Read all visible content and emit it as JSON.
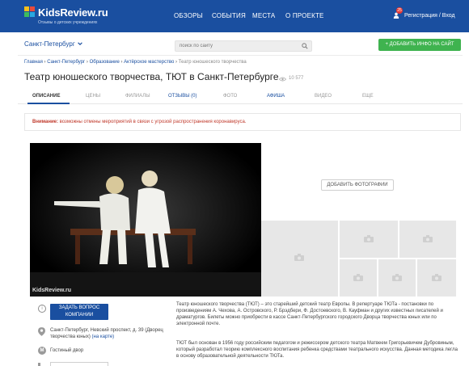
{
  "header": {
    "brand": "KidsReview.ru",
    "tagline": "Отзывы о детских учреждениях",
    "nav": [
      {
        "label": "ОБЗОРЫ"
      },
      {
        "label": "СОБЫТИЯ"
      },
      {
        "label": "МЕСТА"
      },
      {
        "label": "О ПРОЕКТЕ"
      }
    ],
    "notification_count": "25",
    "login_label": "Регистрация / Вход",
    "colors": {
      "bar": "#1a4fa0",
      "logo": [
        "#f7c01b",
        "#e94b3c",
        "#3dbb5e",
        "#29a7df"
      ]
    }
  },
  "subheader": {
    "city": "Санкт-Петербург",
    "search_placeholder": "поиск по сайту",
    "add_button": "+ ДОБАВИТЬ ИНФО НА САЙТ"
  },
  "breadcrumb": {
    "items": [
      "Главная",
      "Санкт-Петербург",
      "Образование",
      "Актёрское мастерство"
    ],
    "current": "Театр юношеского творчества"
  },
  "page": {
    "title": "Театр юношеского творчества, ТЮТ в Санкт-Петербурге",
    "views": "10 577"
  },
  "tabs": [
    {
      "label": "ОПИСАНИЕ",
      "state": "active"
    },
    {
      "label": "ЦЕНЫ",
      "state": "normal"
    },
    {
      "label": "ФИЛИАЛЫ",
      "state": "normal"
    },
    {
      "label": "ОТЗЫВЫ (0)",
      "state": "link"
    },
    {
      "label": "ФОТО",
      "state": "normal"
    },
    {
      "label": "АФИША",
      "state": "link"
    },
    {
      "label": "ВИДЕО",
      "state": "normal"
    },
    {
      "label": "ЕЩЕ",
      "state": "normal"
    }
  ],
  "notice": {
    "label": "Внимание:",
    "text": "возможны отмены мероприятий в связи с угрозой распространения коронавируса."
  },
  "gallery": {
    "watermark": "KidsReview.ru",
    "add_photo_label": "ДОБАВИТЬ ФОТОГРАФИИ",
    "icons": [
      "camera-icon"
    ]
  },
  "contact": {
    "ask_button": "ЗАДАТЬ ВОПРОС КОМПАНИИ",
    "address": "Санкт-Петербург, Невский проспект, д. 39 (Дворец творчества юных)",
    "map_link": "(на карте)",
    "metro": "Гостиный двор",
    "metro_letter": "М",
    "info_symbol": "i"
  },
  "description": {
    "p1": "Театр юношеского творчества (ТЮТ) – это старейший детский театр Европы. В репертуаре ТЮТа - постановки по произведениям А. Чехова, А. Островского, Р. Брэдбери, Ф. Достоевского, В. Кауфман и других известных писателей и драматургов. Билеты можно приобрести в кассе Санкт-Петербургского городского Дворца творчества юных или по электронной почте.",
    "p2": "ТЮТ был основан в 1956 году российским педагогом и режиссером детского театра Матвеем Григорьевичем Дубровиным, который разработал теорию комплексного воспитания ребенка средствами театрального искусства. Данная методика легла в основу образовательной деятельности ТЮТа."
  }
}
